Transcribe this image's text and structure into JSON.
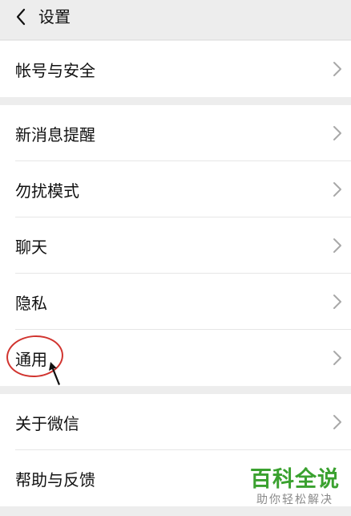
{
  "header": {
    "title": "设置",
    "back_icon": "chevron-left-icon"
  },
  "groups": [
    {
      "items": [
        {
          "label": "帐号与安全"
        }
      ]
    },
    {
      "items": [
        {
          "label": "新消息提醒"
        },
        {
          "label": "勿扰模式"
        },
        {
          "label": "聊天"
        },
        {
          "label": "隐私"
        },
        {
          "label": "通用"
        }
      ]
    },
    {
      "items": [
        {
          "label": "关于微信"
        },
        {
          "label": "帮助与反馈"
        }
      ]
    }
  ],
  "annotation": {
    "highlight_color": "#d1342f"
  },
  "watermark": {
    "main": "百科全说",
    "sub": "助你轻松解决",
    "color": "#3aa12f"
  }
}
